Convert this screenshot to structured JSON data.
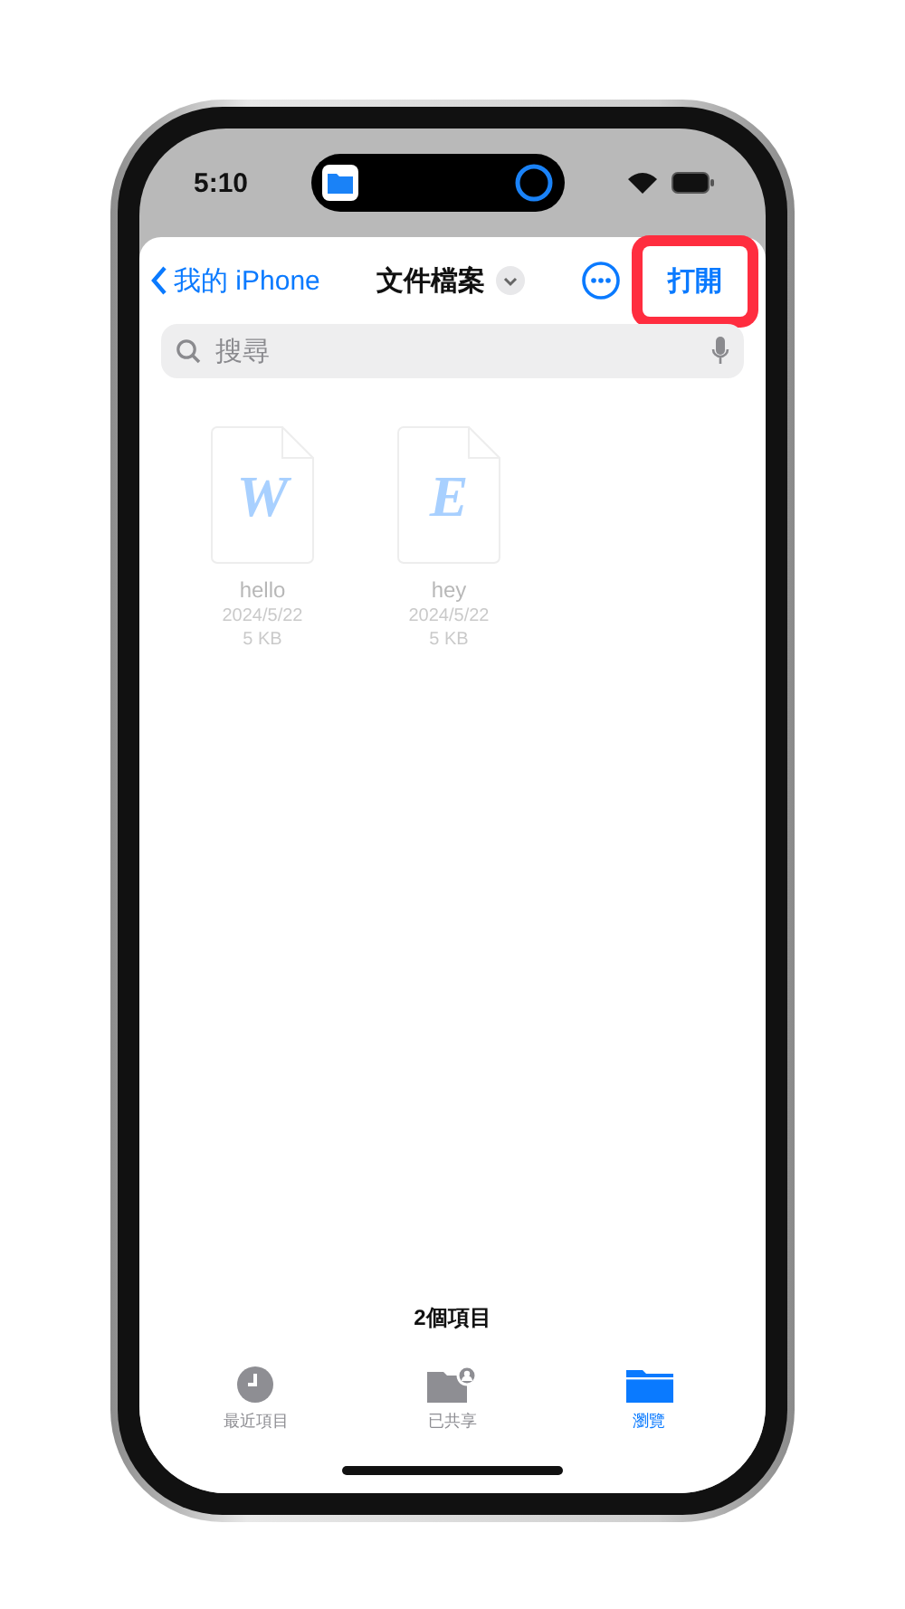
{
  "status_bar": {
    "time": "5:10"
  },
  "nav": {
    "back": "我的 iPhone",
    "title": "文件檔案",
    "action": {
      "label": "打開",
      "highlighted": true
    }
  },
  "search": {
    "placeholder": "搜尋"
  },
  "files": [
    {
      "letter": "W",
      "name": "hello",
      "date": "2024/5/22",
      "size": "5 KB",
      "disabled": true
    },
    {
      "letter": "E",
      "name": "hey",
      "date": "2024/5/22",
      "size": "5 KB",
      "disabled": true
    }
  ],
  "item_count": "2個項目",
  "tabs": [
    {
      "kind": "recent",
      "label": "最近項目",
      "selected": false
    },
    {
      "kind": "shared",
      "label": "已共享",
      "selected": false
    },
    {
      "kind": "browse",
      "label": "瀏覽",
      "selected": true
    }
  ]
}
